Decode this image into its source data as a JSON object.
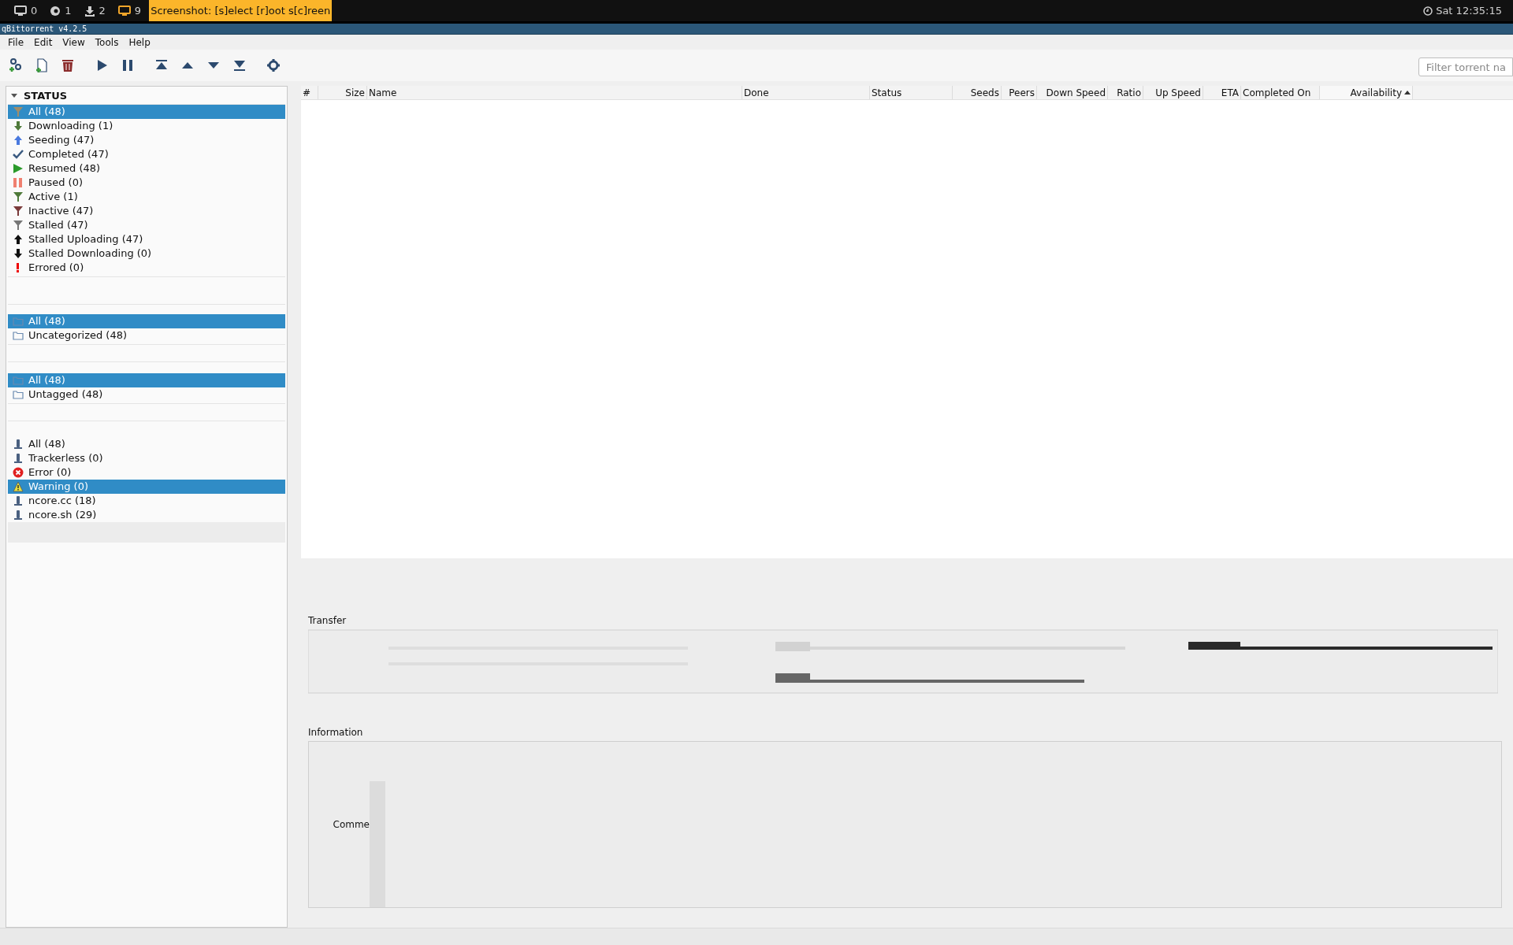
{
  "taskbar": {
    "workspaces": [
      {
        "kind": "monitor",
        "label": "0"
      },
      {
        "kind": "browser",
        "label": "1"
      },
      {
        "kind": "download",
        "label": "2"
      },
      {
        "kind": "screen",
        "label": "9"
      }
    ],
    "active_window": "Screenshot: [s]elect [r]oot s[c]reen",
    "clock": "Sat 12:35:15"
  },
  "window": {
    "title": "qBittorrent v4.2.5"
  },
  "menu": [
    "File",
    "Edit",
    "View",
    "Tools",
    "Help"
  ],
  "toolbar": [
    {
      "kind": "add-link"
    },
    {
      "kind": "add-file"
    },
    {
      "kind": "delete"
    },
    {
      "kind": "resume"
    },
    {
      "kind": "pause"
    },
    {
      "kind": "top"
    },
    {
      "kind": "up"
    },
    {
      "kind": "down"
    },
    {
      "kind": "bottom"
    },
    {
      "kind": "options"
    }
  ],
  "search": {
    "placeholder": "Filter torrent na"
  },
  "sidebar": {
    "status": {
      "title": "STATUS",
      "expanded": true,
      "items": [
        {
          "kind": "all",
          "label": "All (48)",
          "selected": true
        },
        {
          "kind": "downloading",
          "label": "Downloading (1)",
          "selected": false
        },
        {
          "kind": "seeding",
          "label": "Seeding (47)",
          "selected": false
        },
        {
          "kind": "completed",
          "label": "Completed (47)",
          "selected": false
        },
        {
          "kind": "resumed",
          "label": "Resumed (48)",
          "selected": false
        },
        {
          "kind": "paused",
          "label": "Paused (0)",
          "selected": false
        },
        {
          "kind": "active",
          "label": "Active (1)",
          "selected": false
        },
        {
          "kind": "inactive",
          "label": "Inactive (47)",
          "selected": false
        },
        {
          "kind": "stalled",
          "label": "Stalled (47)",
          "selected": false
        },
        {
          "kind": "stalledup",
          "label": "Stalled Uploading (47)",
          "selected": false
        },
        {
          "kind": "stalleddown",
          "label": "Stalled Downloading (0)",
          "selected": false
        },
        {
          "kind": "errored",
          "label": "Errored (0)",
          "selected": false
        }
      ]
    },
    "categories": {
      "items": [
        {
          "label": "All (48)",
          "selected": true
        },
        {
          "label": "Uncategorized (48)",
          "selected": false
        }
      ]
    },
    "tags": {
      "items": [
        {
          "label": "All (48)",
          "selected": true
        },
        {
          "label": "Untagged (48)",
          "selected": false
        }
      ]
    },
    "trackers": {
      "items": [
        {
          "kind": "tracker",
          "label": "All (48)",
          "selected": false
        },
        {
          "kind": "tracker",
          "label": "Trackerless (0)",
          "selected": false
        },
        {
          "kind": "error",
          "label": "Error (0)",
          "selected": false
        },
        {
          "kind": "warning",
          "label": "Warning (0)",
          "selected": true
        },
        {
          "kind": "tracker",
          "label": "ncore.cc (18)",
          "selected": false
        },
        {
          "kind": "tracker",
          "label": "ncore.sh (29)",
          "selected": false
        }
      ]
    }
  },
  "table": {
    "columns": [
      {
        "label": "#",
        "sorted": false
      },
      {
        "label": "Size",
        "sorted": false
      },
      {
        "label": "Name",
        "sorted": false
      },
      {
        "label": "Done",
        "sorted": false
      },
      {
        "label": "Status",
        "sorted": false
      },
      {
        "label": "Seeds",
        "sorted": false
      },
      {
        "label": "Peers",
        "sorted": false
      },
      {
        "label": "Down Speed",
        "sorted": false
      },
      {
        "label": "Ratio",
        "sorted": false
      },
      {
        "label": "Up Speed",
        "sorted": false
      },
      {
        "label": "ETA",
        "sorted": false
      },
      {
        "label": "Completed On",
        "sorted": false
      },
      {
        "label": "Availability",
        "sorted": true
      }
    ]
  },
  "details": {
    "transfer": {
      "title": "Transfer"
    },
    "information": {
      "title": "Information",
      "label": "Comme"
    }
  }
}
